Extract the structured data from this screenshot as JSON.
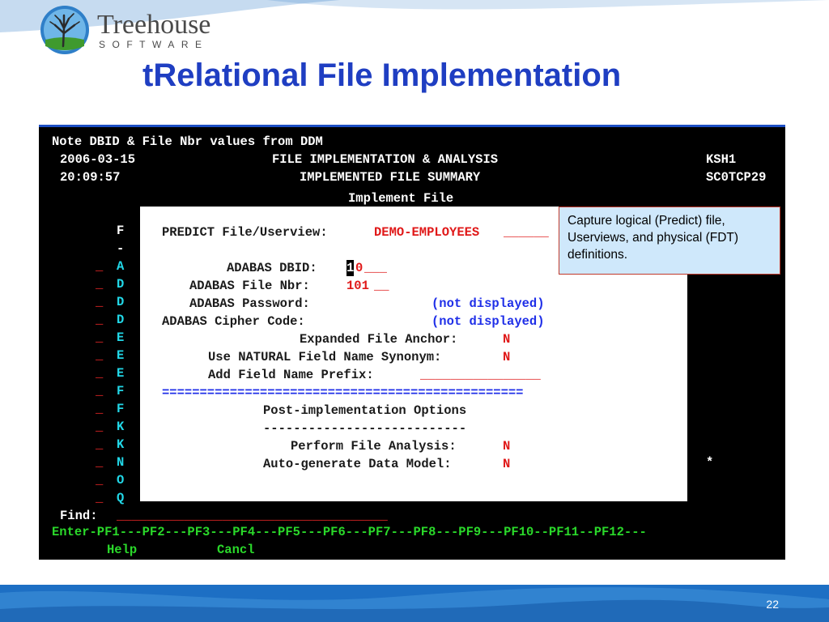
{
  "logo": {
    "name": "Treehouse",
    "tagline": "SOFTWARE"
  },
  "slide": {
    "title": "tRelational File Implementation",
    "page_number": "22"
  },
  "colors": {
    "title": "#1f3ec2",
    "band": "#1d6fc4",
    "callout_bg": "#cfe8fb",
    "callout_border": "#c0392b",
    "term_bg": "#000000"
  },
  "terminal": {
    "header_note": "Note DBID & File Nbr values from DDM",
    "date": "2006-03-15",
    "time": "20:09:57",
    "screen_title": "FILE IMPLEMENTATION & ANALYSIS",
    "screen_subtitle": "IMPLEMENTED FILE SUMMARY",
    "user_id": "KSH1",
    "screen_id": "SC0TCP29",
    "column_header": "F",
    "column_dash": "-",
    "rows": [
      {
        "select": "_",
        "code": "A"
      },
      {
        "select": "_",
        "code": "D"
      },
      {
        "select": "_",
        "code": "D"
      },
      {
        "select": "_",
        "code": "D"
      },
      {
        "select": "_",
        "code": "E"
      },
      {
        "select": "_",
        "code": "E"
      },
      {
        "select": "_",
        "code": "E"
      },
      {
        "select": "_",
        "code": "F"
      },
      {
        "select": "_",
        "code": "F"
      },
      {
        "select": "_",
        "code": "K"
      },
      {
        "select": "_",
        "code": "K"
      },
      {
        "select": "_",
        "code": "N"
      },
      {
        "select": "_",
        "code": "O"
      },
      {
        "select": "_",
        "code": "Q"
      }
    ],
    "right_marker": "*",
    "find_label": "Find:",
    "find_value": "____________________________________",
    "pf_line": "Enter-PF1---PF2---PF3---PF4---PF5---PF6---PF7---PF8---PF9---PF10--PF11--PF12---",
    "pf1_label": "Help",
    "pf3_label": "Cancl"
  },
  "popup": {
    "title": "Implement File",
    "predict_label": "PREDICT File/Userview:",
    "predict_value": "DEMO-EMPLOYEES",
    "predict_fill": "______",
    "dbid_label": "ADABAS DBID:",
    "dbid_cursor": "1",
    "dbid_value": "0",
    "dbid_fill": "___",
    "file_nbr_label": "ADABAS File Nbr:",
    "file_nbr_value": "101",
    "file_nbr_fill": "__",
    "password_label": "ADABAS Password:",
    "password_value": "(not displayed)",
    "cipher_label": "ADABAS Cipher Code:",
    "cipher_value": "(not displayed)",
    "anchor_label": "Expanded File Anchor:",
    "anchor_value": "N",
    "synonym_label": "Use NATURAL Field Name Synonym:",
    "synonym_value": "N",
    "prefix_label": "Add Field Name Prefix:",
    "prefix_value": "________________",
    "separator": "================================================",
    "post_title": "Post-implementation Options",
    "post_rule": "---------------------------",
    "analysis_label": "Perform File Analysis:",
    "analysis_value": "N",
    "datamodel_label": "Auto-generate Data Model:",
    "datamodel_value": "N"
  },
  "callout": {
    "text": "Capture logical (Predict) file, Userviews, and physical (FDT) definitions."
  }
}
